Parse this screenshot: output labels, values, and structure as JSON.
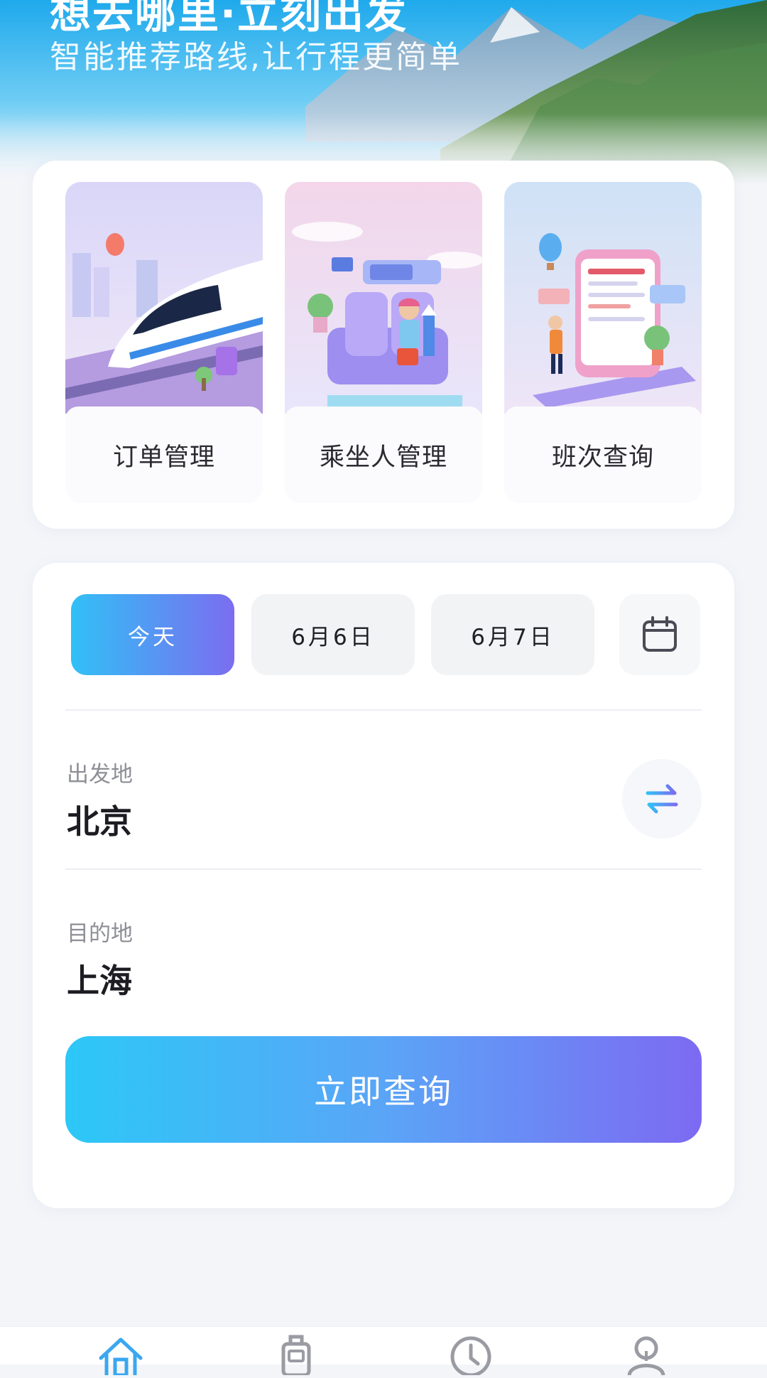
{
  "hero": {
    "title": "想去哪里·立刻出发",
    "subtitle": "智能推荐路线,让行程更简单"
  },
  "quick_entries": [
    {
      "label": "订单管理",
      "icon": "train-illustration"
    },
    {
      "label": "乘坐人管理",
      "icon": "passenger-seat-illustration"
    },
    {
      "label": "班次查询",
      "icon": "schedule-board-illustration"
    }
  ],
  "dates": {
    "chips": [
      "今天",
      "6月6日",
      "6月7日"
    ],
    "selected_index": 0,
    "calendar_icon": "calendar-icon"
  },
  "route": {
    "departure_label": "出发地",
    "departure_value": "北京",
    "destination_label": "目的地",
    "destination_value": "上海",
    "swap_icon": "swap-arrows-icon"
  },
  "query_button_label": "立即查询",
  "bottom_nav": {
    "items": [
      "home-icon",
      "luggage-icon",
      "clock-icon",
      "profile-icon"
    ],
    "active_index": 0
  },
  "colors": {
    "accent_start": "#2cc8f7",
    "accent_end": "#7d6af2",
    "page_bg": "#f3f5f9",
    "nav_active": "#3aa7f0",
    "nav_inactive": "#9a9ba3"
  }
}
